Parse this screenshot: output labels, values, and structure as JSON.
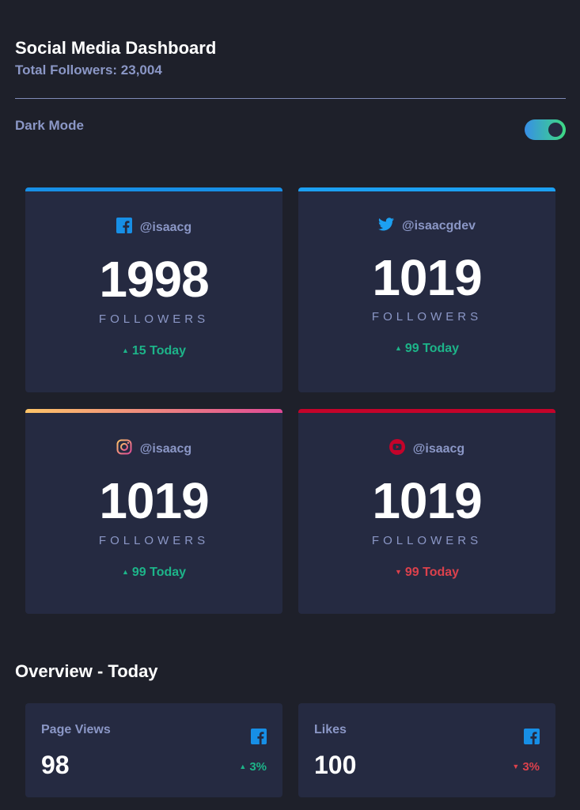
{
  "header": {
    "title": "Social Media Dashboard",
    "total_followers": "Total Followers: 23,004"
  },
  "theme": {
    "mode_label": "Dark Mode",
    "dark_mode_on": true
  },
  "colors": {
    "background": "#1e202a",
    "card": "#252a41",
    "muted_text": "#8b97c6",
    "up": "#1db489",
    "down": "#dc414c",
    "facebook": "#178fe6",
    "twitter": "#1ca0f2",
    "instagram_gradient": [
      "#fdc468",
      "#df4996"
    ],
    "youtube": "#c4032a"
  },
  "cards": [
    {
      "platform": "facebook",
      "icon": "facebook-icon",
      "handle": "@isaacg",
      "count": "1998",
      "label": "FOLLOWERS",
      "delta": "15 Today",
      "trend": "up"
    },
    {
      "platform": "twitter",
      "icon": "twitter-icon",
      "handle": "@isaacgdev",
      "count": "1019",
      "label": "FOLLOWERS",
      "delta": "99 Today",
      "trend": "up"
    },
    {
      "platform": "instagram",
      "icon": "instagram-icon",
      "handle": "@isaacg",
      "count": "1019",
      "label": "FOLLOWERS",
      "delta": "99 Today",
      "trend": "up"
    },
    {
      "platform": "youtube",
      "icon": "youtube-icon",
      "handle": "@isaacg",
      "count": "1019",
      "label": "FOLLOWERS",
      "delta": "99 Today",
      "trend": "down"
    }
  ],
  "overview": {
    "title": "Overview - Today",
    "items": [
      {
        "label": "Page Views",
        "icon": "facebook-icon",
        "value": "98",
        "change": "3%",
        "trend": "up"
      },
      {
        "label": "Likes",
        "icon": "facebook-icon",
        "value": "100",
        "change": "3%",
        "trend": "down"
      }
    ]
  }
}
